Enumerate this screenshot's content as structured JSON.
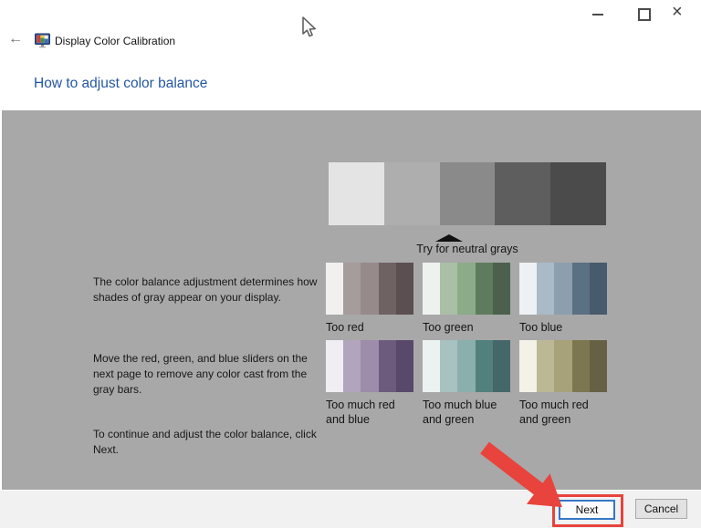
{
  "titlebar": {
    "close_glyph": "×"
  },
  "header": {
    "back_glyph": "←",
    "app_title": "Display Color Calibration",
    "page_title": "How to adjust color balance"
  },
  "instructions": {
    "para1": "The color balance adjustment determines how shades of gray appear on your display.",
    "para2": "Move the red, green, and blue sliders on the next page to remove any color cast from the gray bars.",
    "para3": "To continue and adjust the color balance, click Next."
  },
  "gray_strip": {
    "caption": "Try for neutral grays",
    "segments": [
      "#e5e4e4",
      "#aeaeae",
      "#8a8a8a",
      "#5e5e5e",
      "#4b4b4b"
    ]
  },
  "swatches": {
    "items": [
      {
        "label": "Too red",
        "colors": [
          "#f2f0ef",
          "#a79c9c",
          "#968a8b",
          "#6f6263",
          "#5c4f50"
        ]
      },
      {
        "label": "Too green",
        "colors": [
          "#eef2ee",
          "#a9bfa6",
          "#8cab88",
          "#5e7c5d",
          "#4d604d"
        ]
      },
      {
        "label": "Too blue",
        "colors": [
          "#edf1f4",
          "#aabac7",
          "#8d9fae",
          "#5a7083",
          "#485a6d"
        ]
      },
      {
        "label": "Too much red and blue",
        "colors": [
          "#f1eef3",
          "#b2a4bc",
          "#9d8caa",
          "#6c5b7d",
          "#584869"
        ]
      },
      {
        "label": "Too much blue and green",
        "colors": [
          "#ecf2f1",
          "#a7c2c0",
          "#8aafac",
          "#52807d",
          "#446869"
        ]
      },
      {
        "label": "Too much red and green",
        "colors": [
          "#f3f1e8",
          "#bcb896",
          "#a7a27a",
          "#7c7750",
          "#666145"
        ]
      }
    ]
  },
  "footer": {
    "next_label": "Next",
    "cancel_label": "Cancel"
  },
  "colors": {
    "accent_blue": "#2456a5",
    "panel_gray": "#a8a8a8",
    "footer_bg": "#f1f1f1",
    "annotation_red": "#e8433c",
    "button_focus_blue": "#3577c6"
  }
}
